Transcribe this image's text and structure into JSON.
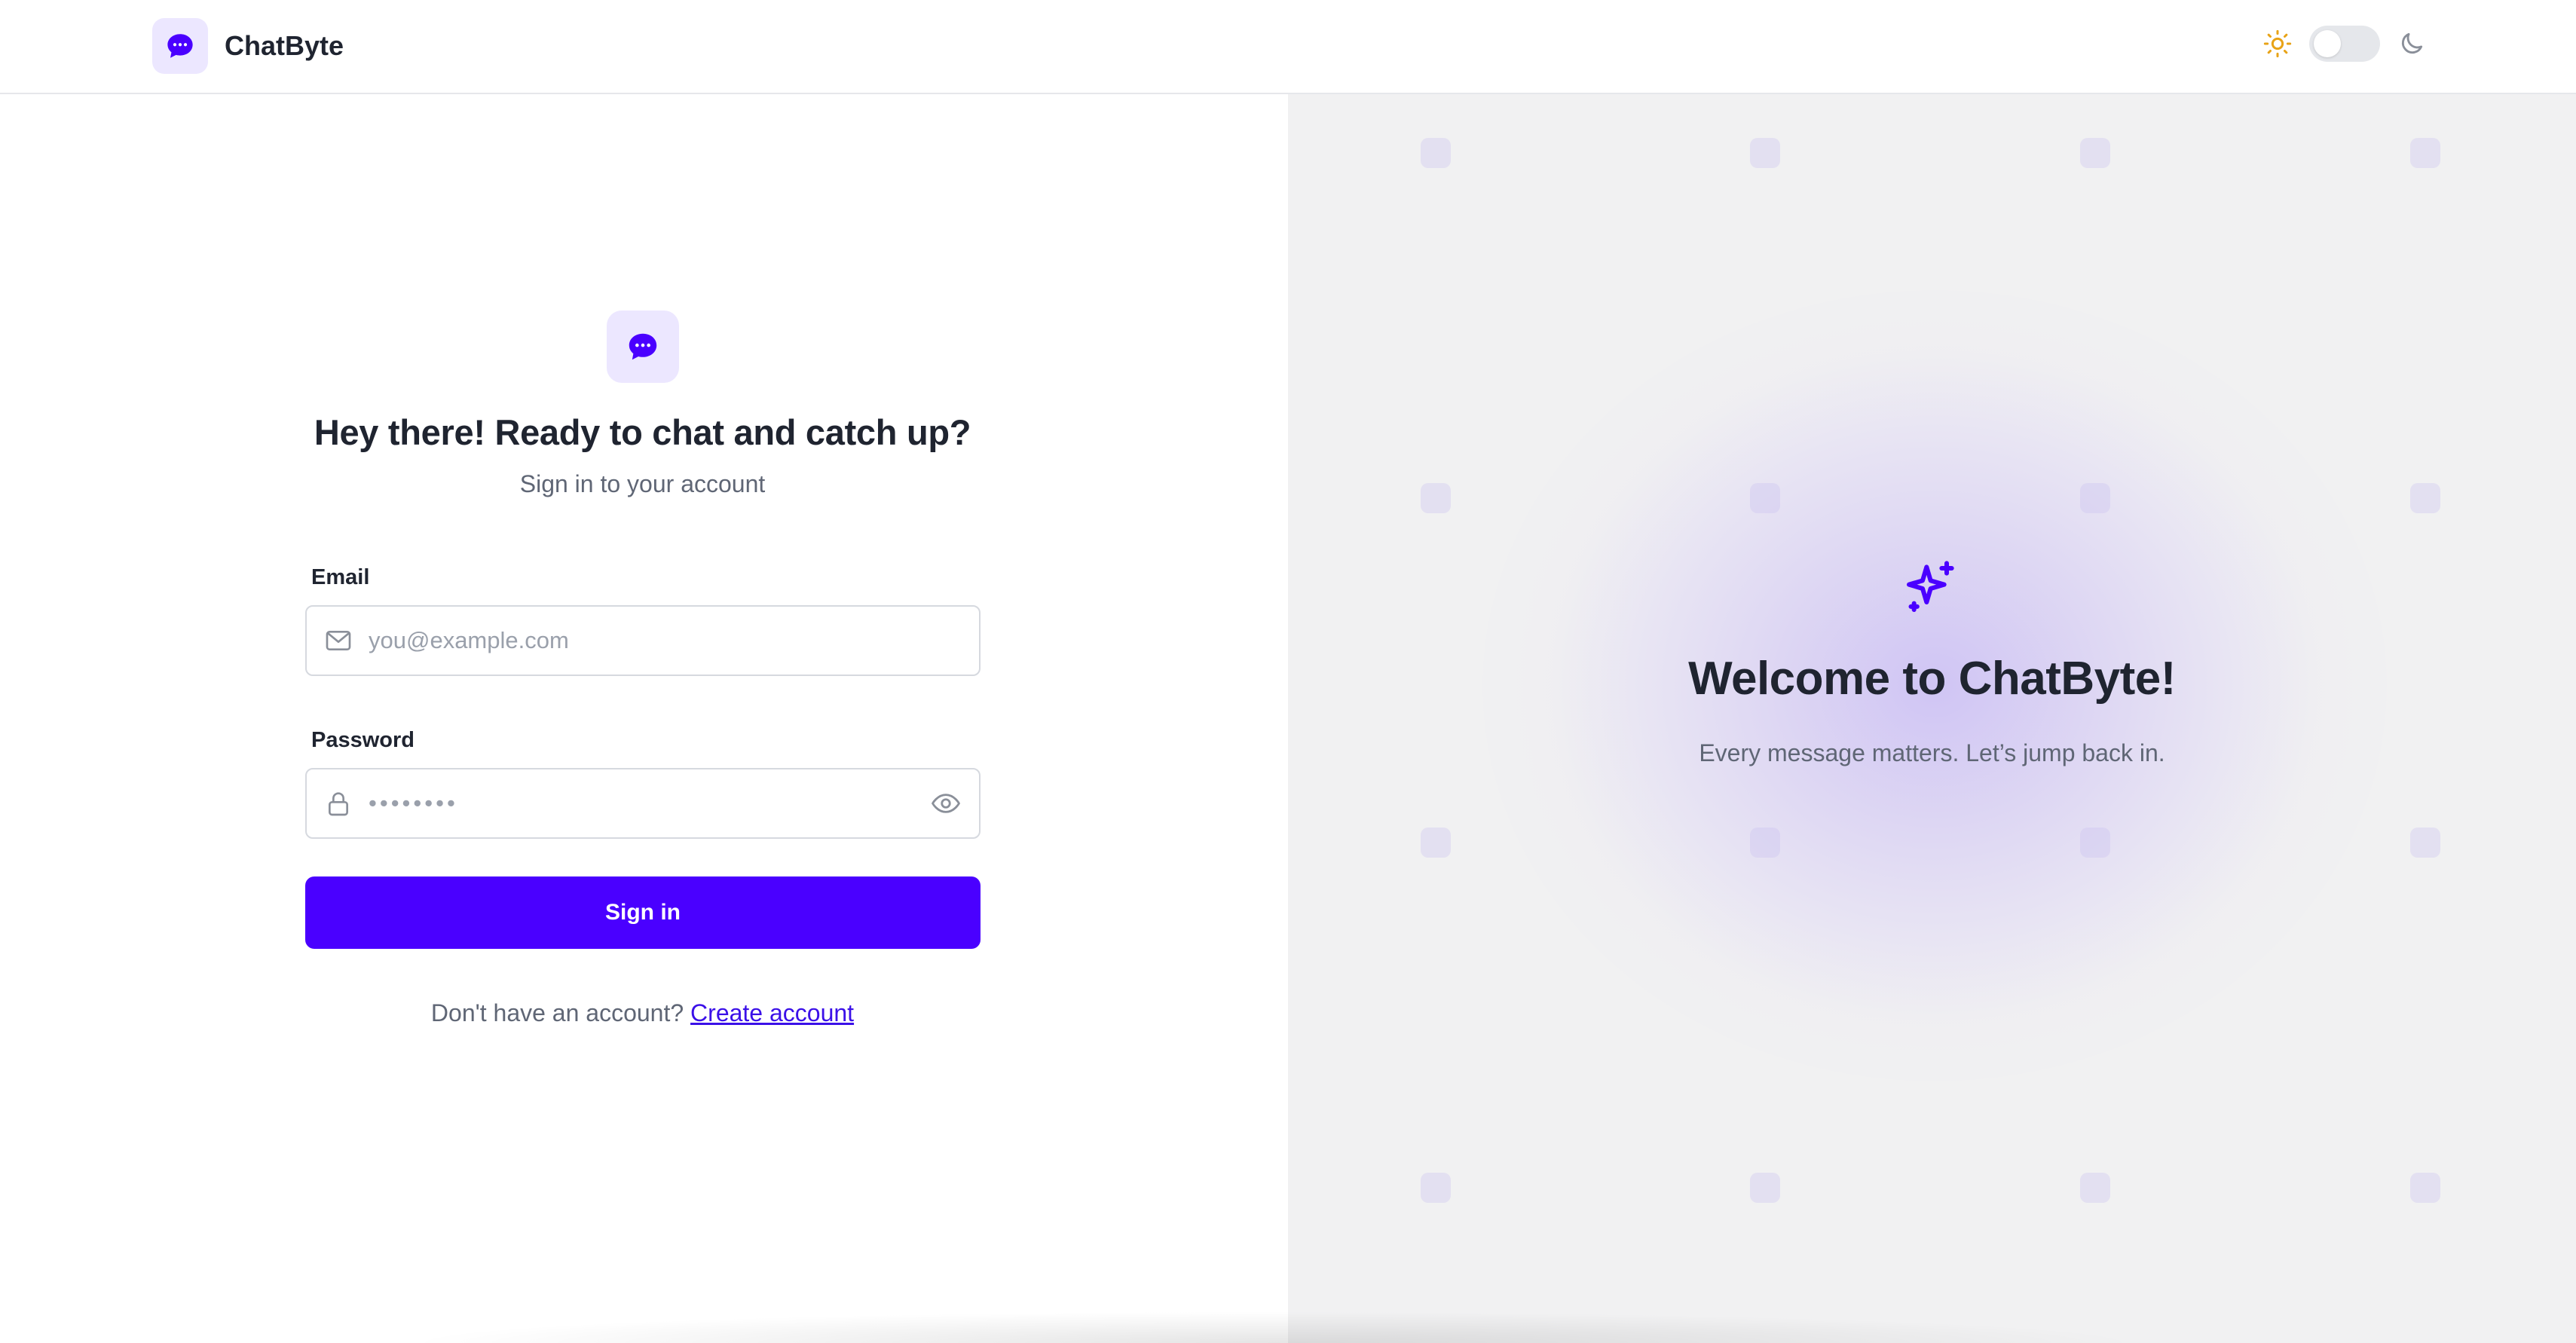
{
  "header": {
    "brand_name": "ChatByte",
    "brand_icon": "chat-bubble-icon",
    "theme_toggle": {
      "light_icon": "sun-icon",
      "dark_icon": "moon-icon",
      "state": "light"
    }
  },
  "login": {
    "icon": "chat-bubble-icon",
    "title": "Hey there! Ready to chat and catch up?",
    "subtitle": "Sign in to your account",
    "email": {
      "label": "Email",
      "placeholder": "you@example.com",
      "value": "",
      "icon": "mail-icon"
    },
    "password": {
      "label": "Password",
      "placeholder": "••••••••",
      "value": "",
      "icon": "lock-icon",
      "toggle_icon": "eye-icon"
    },
    "submit_label": "Sign in",
    "signup_prompt": "Don't have an account?",
    "signup_link": "Create account"
  },
  "promo": {
    "icon": "sparkles-icon",
    "title": "Welcome to ChatByte!",
    "subtitle": "Every message matters. Let’s jump back in."
  },
  "colors": {
    "accent": "#4a00ff",
    "accent_soft": "#ece7ff",
    "sun": "#e8a317",
    "right_pane_bg": "#f1f1f2"
  }
}
